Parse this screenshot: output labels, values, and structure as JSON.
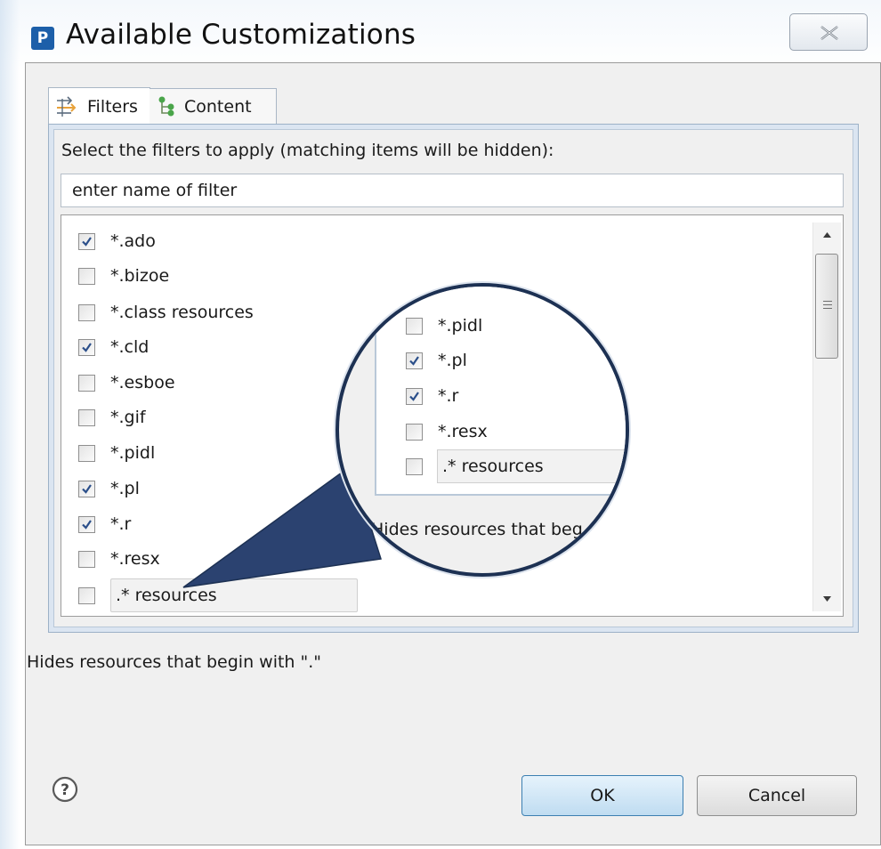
{
  "window": {
    "title": "Available Customizations",
    "app_icon_letter": "P",
    "close_icon": "close-icon"
  },
  "tabs": [
    {
      "label": "Filters",
      "icon": "filters-icon",
      "active": true
    },
    {
      "label": "Content",
      "icon": "content-tree-icon",
      "active": false
    }
  ],
  "filters": {
    "instruction": "Select the filters to apply (matching items will be hidden):",
    "search_placeholder": "enter name of filter",
    "items": [
      {
        "label": "*.ado",
        "checked": true
      },
      {
        "label": "*.bizoe",
        "checked": false
      },
      {
        "label": "*.class resources",
        "checked": false
      },
      {
        "label": "*.cld",
        "checked": true
      },
      {
        "label": "*.esboe",
        "checked": false
      },
      {
        "label": "*.gif",
        "checked": false
      },
      {
        "label": "*.pidl",
        "checked": false
      },
      {
        "label": "*.pl",
        "checked": true
      },
      {
        "label": "*.r",
        "checked": true
      },
      {
        "label": "*.resx",
        "checked": false
      },
      {
        "label": ".* resources",
        "checked": false
      }
    ],
    "description": "Hides resources that begin with \".\""
  },
  "magnifier": {
    "items": [
      {
        "label": "*.pidl",
        "checked": false
      },
      {
        "label": "*.pl",
        "checked": true
      },
      {
        "label": "*.r",
        "checked": true
      },
      {
        "label": "*.resx",
        "checked": false
      },
      {
        "label": ".* resources",
        "checked": false
      }
    ],
    "description": "Hides resources that beg"
  },
  "buttons": {
    "ok": "OK",
    "cancel": "Cancel",
    "help_icon": "help-icon"
  },
  "colors": {
    "accent": "#1d5fa9",
    "magnifier_ring": "#1d3153",
    "ok_border": "#3c7fb1"
  }
}
